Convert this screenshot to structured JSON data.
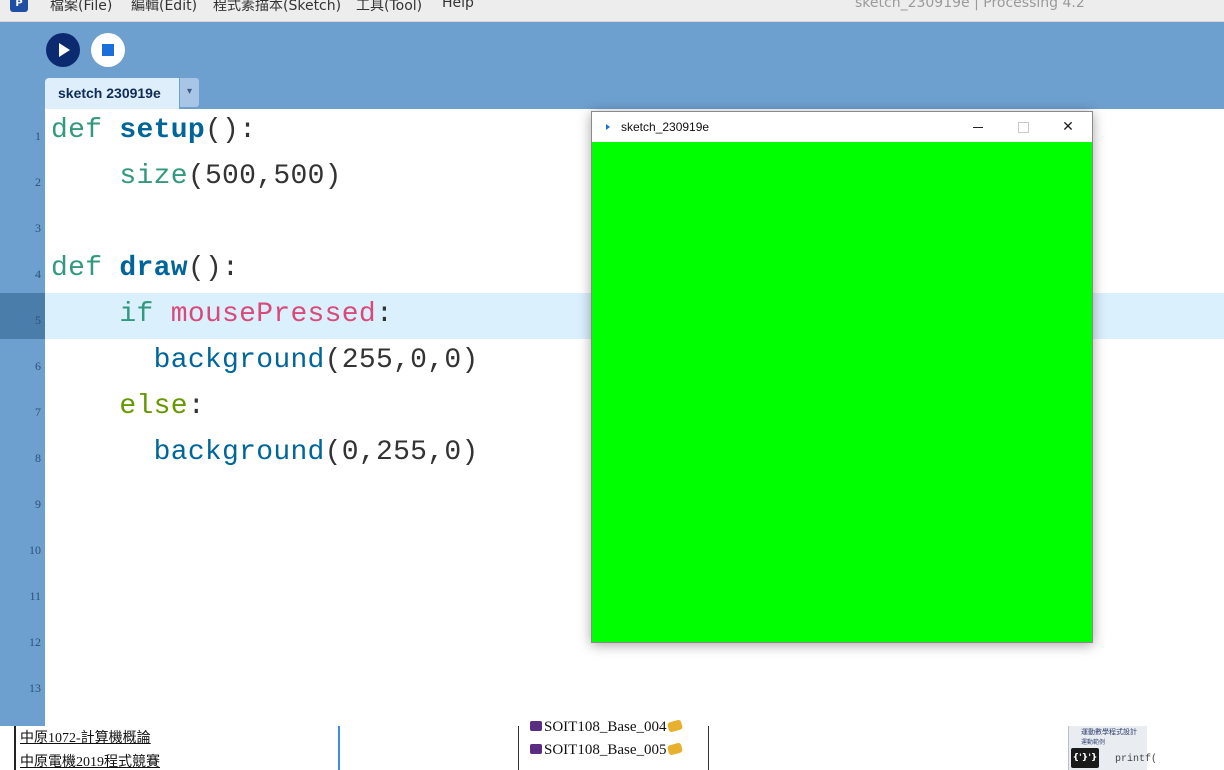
{
  "menubar": {
    "app_icon": "P",
    "items": [
      "檔案(File)",
      "編輯(Edit)",
      "程式素描本(Sketch)",
      "工具(Tool)",
      "Help"
    ],
    "window_title": "sketch_230919e | Processing 4.2"
  },
  "toolbar": {
    "run_icon": "play-icon",
    "stop_icon": "stop-icon",
    "tab_label": "sketch 230919e",
    "tab_arrow": "▾"
  },
  "editor": {
    "line_numbers": [
      "1",
      "2",
      "3",
      "4",
      "5",
      "6",
      "7",
      "8",
      "9",
      "10",
      "11",
      "12",
      "13"
    ],
    "highlighted_line": 5,
    "lines": [
      {
        "parts": [
          [
            "kw",
            "def "
          ],
          [
            "fn",
            "setup"
          ],
          [
            "punct",
            "():"
          ]
        ]
      },
      {
        "parts": [
          [
            "punct",
            "    "
          ],
          [
            "kw",
            "size"
          ],
          [
            "punct",
            "(500,500)"
          ]
        ]
      },
      {
        "parts": []
      },
      {
        "parts": [
          [
            "kw",
            "def "
          ],
          [
            "fn",
            "draw"
          ],
          [
            "punct",
            "():"
          ]
        ]
      },
      {
        "parts": [
          [
            "punct",
            "    "
          ],
          [
            "kw",
            "if "
          ],
          [
            "var",
            "mousePressed"
          ],
          [
            "punct",
            ":"
          ]
        ]
      },
      {
        "parts": [
          [
            "punct",
            "      "
          ],
          [
            "fn2",
            "background"
          ],
          [
            "punct",
            "(255,0,0)"
          ]
        ]
      },
      {
        "parts": [
          [
            "punct",
            "    "
          ],
          [
            "ctl",
            "else"
          ],
          [
            "punct",
            ":"
          ]
        ]
      },
      {
        "parts": [
          [
            "punct",
            "      "
          ],
          [
            "fn2",
            "background"
          ],
          [
            "punct",
            "(0,255,0)"
          ]
        ]
      }
    ]
  },
  "sketch_window": {
    "title": "sketch_230919e",
    "close_glyph": "✕",
    "canvas_color": "#00ff00"
  },
  "bottom_strip": {
    "links": [
      "中原1072-計算機概論",
      "中原電機2019程式競賽"
    ],
    "files": [
      "SOIT108_Base_004",
      "SOIT108_Base_005"
    ],
    "thumb_title": "運動數學程式設計",
    "thumb_sub": "運動範例",
    "thumb_code": "printf("
  },
  "colors": {
    "accent_blue": "#6d9fcf",
    "run_button": "#0b2a6f",
    "canvas_green": "#00ff00"
  }
}
